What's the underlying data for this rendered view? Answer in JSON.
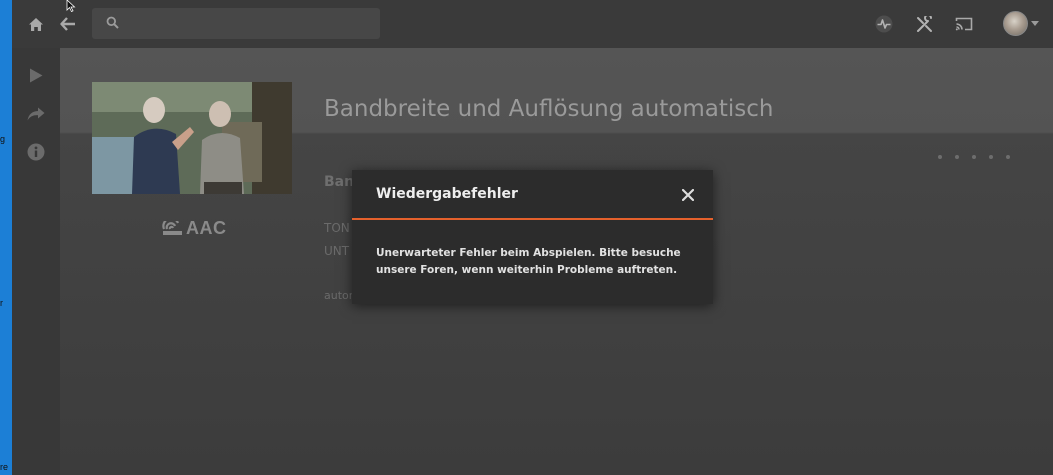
{
  "desktop": {
    "edge_text": [
      "g",
      "r",
      "re"
    ]
  },
  "topbar": {
    "home_icon": "home-icon",
    "back_icon": "back-arrow-icon",
    "search": {
      "value": "",
      "placeholder": ""
    },
    "right_icons": [
      "activity-icon",
      "settings-tools-icon",
      "cast-icon"
    ]
  },
  "sidebar": {
    "items": [
      "play-icon",
      "share-icon",
      "info-icon"
    ]
  },
  "media": {
    "title": "Bandbreite und Auflösung automatisch",
    "codec_logo": "AAC",
    "section_heading": "Ban",
    "line_1": "TON",
    "line_2": "UNT",
    "line_3": "autor"
  },
  "dialog": {
    "title": "Wiedergabefehler",
    "message": "Unerwarteter Fehler beim Abspielen. Bitte besuche unsere Foren, wenn weiterhin Probleme auftreten.",
    "accent_color": "#e5612c"
  }
}
